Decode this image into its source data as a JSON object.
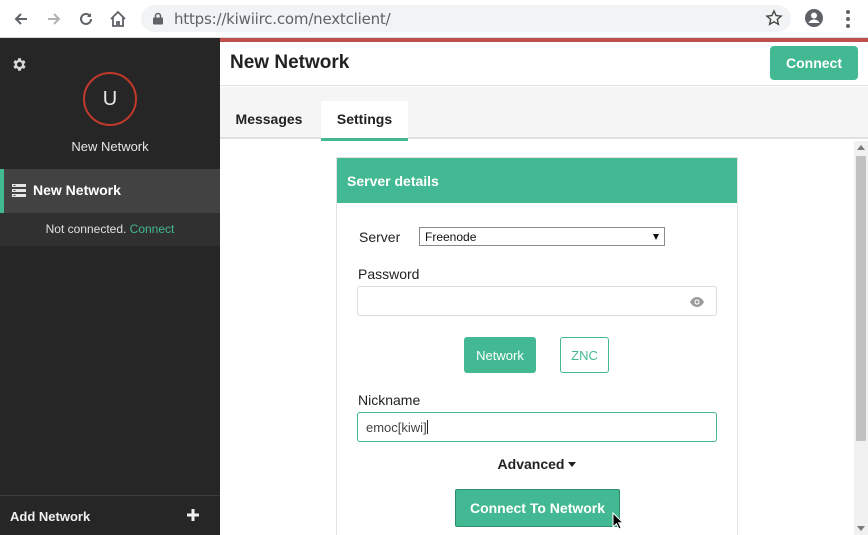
{
  "browser": {
    "url": "https://kiwiirc.com/nextclient/",
    "icons": [
      "back-icon",
      "forward-icon",
      "reload-icon",
      "home-icon",
      "lock-icon",
      "star-icon",
      "profile-icon",
      "menu-dots-icon"
    ]
  },
  "sidebar": {
    "avatar_letter": "U",
    "network_title": "New Network",
    "active_network": "New Network",
    "status_text": "Not connected.",
    "status_link": "Connect",
    "add_network": "Add Network"
  },
  "header": {
    "title": "New Network",
    "connect_label": "Connect"
  },
  "tabs": [
    {
      "label": "Messages",
      "active": false
    },
    {
      "label": "Settings",
      "active": true
    }
  ],
  "server_form": {
    "heading": "Server details",
    "server_label": "Server",
    "server_value": "Freenode",
    "password_label": "Password",
    "password_value": "",
    "network_button": "Network",
    "znc_button": "ZNC",
    "nickname_label": "Nickname",
    "nickname_value": "emoc[kiwi]",
    "advanced_label": "Advanced",
    "connect_button": "Connect To Network"
  },
  "colors": {
    "accent": "#42b992",
    "sidebar_bg": "#262626",
    "topline": "#c0504d",
    "avatar_ring": "#c0392b"
  }
}
